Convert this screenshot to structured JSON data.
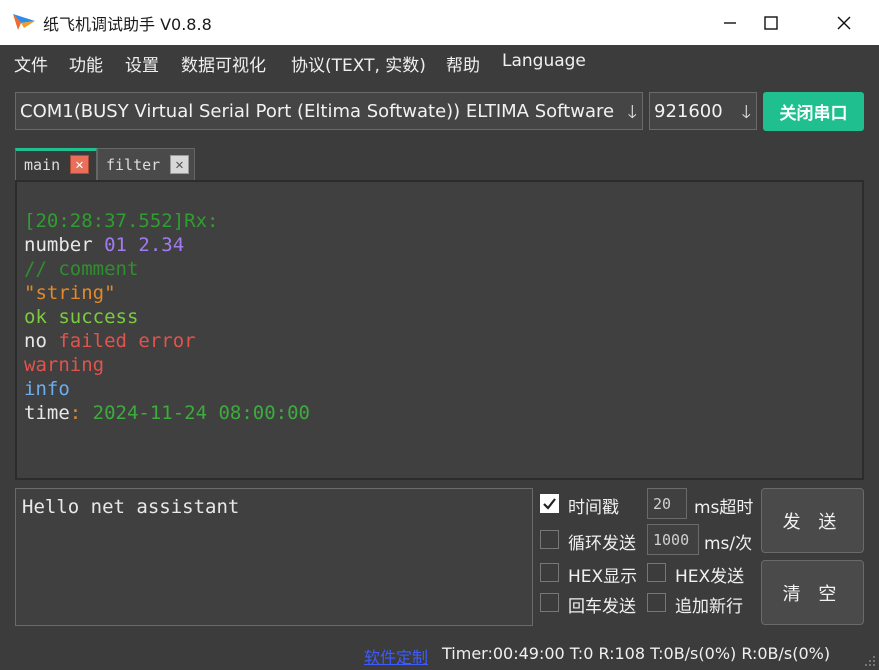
{
  "window": {
    "title": "纸飞机调试助手 V0.8.8"
  },
  "menu": [
    "文件",
    "功能",
    "设置",
    "数据可视化",
    "协议(TEXT, 实数)",
    "帮助",
    "Language"
  ],
  "port": {
    "value": "COM1(BUSY  Virtual Serial Port (Eltima Softwate)) ELTIMA Software"
  },
  "baud": {
    "value": "921600"
  },
  "open_button": "关闭串口",
  "tabs": [
    {
      "label": "main",
      "close": "✕"
    },
    {
      "label": "filter",
      "close": "✕"
    }
  ],
  "terminal": {
    "lines": [
      [
        {
          "text": "[20:28:37.552]Rx:",
          "color": "#2f9e2f"
        }
      ],
      [
        {
          "text": "number ",
          "color": "#e8e8e8"
        },
        {
          "text": "01 2.34",
          "color": "#a07cf0"
        }
      ],
      [
        {
          "text": "// comment",
          "color": "#2f8f2f"
        }
      ],
      [
        {
          "text": "\"string\"",
          "color": "#e08a2a"
        }
      ],
      [
        {
          "text": "ok ",
          "color": "#7acc3c"
        },
        {
          "text": "success",
          "color": "#7acc3c"
        }
      ],
      [
        {
          "text": "no ",
          "color": "#e8e8e8"
        },
        {
          "text": "failed error",
          "color": "#e2534c"
        }
      ],
      [
        {
          "text": "warning",
          "color": "#e2534c"
        }
      ],
      [
        {
          "text": "info",
          "color": "#6aaef0"
        }
      ],
      [
        {
          "text": "time",
          "color": "#e8e8e8"
        },
        {
          "text": ": ",
          "color": "#e08a2a"
        },
        {
          "text": "2024-11-24 08:00:00",
          "color": "#3dab3d"
        }
      ]
    ]
  },
  "send_input": {
    "value": "Hello net assistant"
  },
  "options": {
    "timestamp": {
      "label": "时间戳",
      "checked": true
    },
    "timeout": {
      "value": "20",
      "unit": "ms超时"
    },
    "loop_send": {
      "label": "循环发送",
      "checked": false
    },
    "interval": {
      "value": "1000",
      "unit": "ms/次"
    },
    "hex_display": {
      "label": "HEX显示",
      "checked": false
    },
    "hex_send": {
      "label": "HEX发送",
      "checked": false
    },
    "cr_send": {
      "label": "回车发送",
      "checked": false
    },
    "newline": {
      "label": "追加新行",
      "checked": false
    }
  },
  "buttons": {
    "send": "发 送",
    "clear": "清 空"
  },
  "status": {
    "link": "软件定制",
    "text": "Timer:00:49:00 T:0 R:108  T:0B/s(0%) R:0B/s(0%)"
  },
  "colors": {
    "accent_button": "#1fbf8f",
    "tab_active_line": "#1fbf8f",
    "background": "#3c3c3c",
    "close_active": "#e8705a"
  }
}
